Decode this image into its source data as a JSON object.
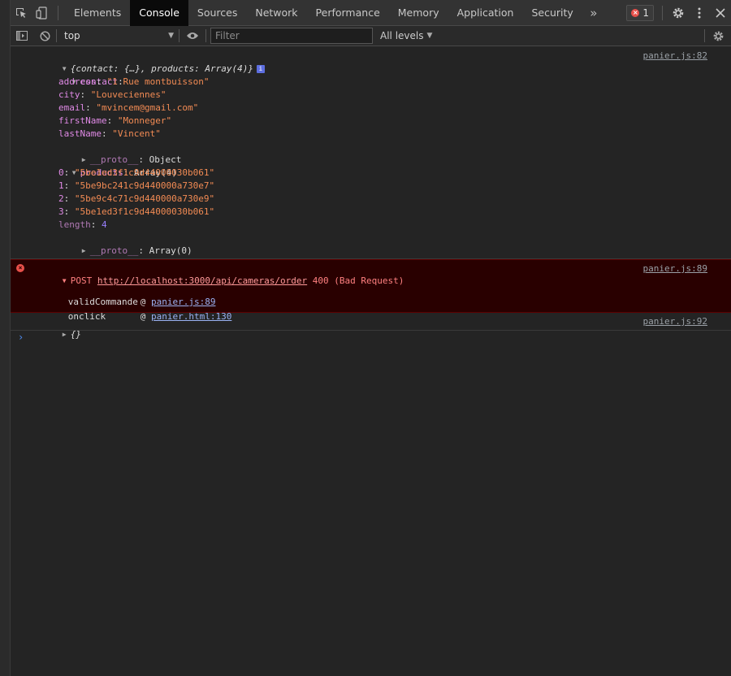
{
  "tabs": [
    "Elements",
    "Console",
    "Sources",
    "Network",
    "Performance",
    "Memory",
    "Application",
    "Security"
  ],
  "active_tab": "Console",
  "more_tabs_glyph": "»",
  "error_count": "1",
  "toolbar": {
    "context": "top",
    "filter_placeholder": "Filter",
    "levels": "All levels"
  },
  "log1": {
    "source": "panier.js:82",
    "summary_open": "{",
    "summary_k1": "contact",
    "summary_v1": "{…}",
    "summary_k2": "products",
    "summary_v2": "Array(4)",
    "summary_close": "}",
    "info_badge": "i",
    "contact_key": "contact",
    "contact_fields": [
      {
        "key": "address",
        "value": "\"1 Rue montbuisson\""
      },
      {
        "key": "city",
        "value": "\"Louveciennes\""
      },
      {
        "key": "email",
        "value": "\"mvincem@gmail.com\""
      },
      {
        "key": "firstName",
        "value": "\"Monneger\""
      },
      {
        "key": "lastName",
        "value": "\"Vincent\""
      }
    ],
    "proto_key": "__proto__",
    "proto_object": "Object",
    "products_key": "products",
    "products_value": "Array(4)",
    "product_items": [
      {
        "key": "0",
        "value": "\"5be1ed3f1c9d44000030b061\""
      },
      {
        "key": "1",
        "value": "\"5be9bc241c9d440000a730e7\""
      },
      {
        "key": "2",
        "value": "\"5be9c4c71c9d440000a730e9\""
      },
      {
        "key": "3",
        "value": "\"5be1ed3f1c9d44000030b061\""
      }
    ],
    "length_key": "length",
    "length_value": "4",
    "proto_array": "Array(0)"
  },
  "error": {
    "source": "panier.js:89",
    "method": "POST",
    "url": "http://localhost:3000/api/cameras/order",
    "status": "400 (Bad Request)",
    "stack": [
      {
        "fn": "validCommande",
        "at": "@",
        "loc": "panier.js:89"
      },
      {
        "fn": "onclick",
        "at": "@",
        "loc": "panier.html:130"
      }
    ]
  },
  "log2": {
    "source": "panier.js:92",
    "value": "{}"
  },
  "prompt_glyph": "›"
}
